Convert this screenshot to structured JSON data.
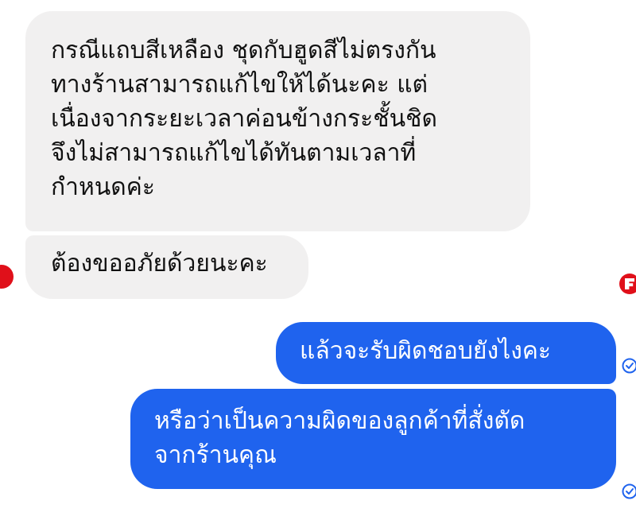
{
  "conversation": {
    "messages": [
      {
        "direction": "incoming",
        "text": "กรณีแถบสีเหลือง ชุดกับฮูดสีไม่ตรงกัน\nทางร้านสามารถแก้ไขให้ได้นะคะ แต่\nเนื่องจากระยะเวลาค่อนข้างกระชั้นชิด\nจึงไม่สามารถแก้ไขได้ทันตามเวลาที่\nกำหนดค่ะ"
      },
      {
        "direction": "incoming",
        "text": "ต้องขออภัยด้วยนะคะ"
      },
      {
        "direction": "outgoing",
        "text": "แล้วจะรับผิดชอบยังไงคะ"
      },
      {
        "direction": "outgoing",
        "text": "หรือว่าเป็นความผิดของลูกค้าที่สั่งตัด\nจากร้านคุณ"
      }
    ]
  },
  "colors": {
    "incoming_bubble": "#f1f0f0",
    "outgoing_bubble": "#1f63ee",
    "avatar": "#e0101a",
    "status_icon": "#1f63ee"
  },
  "icons": {
    "left_avatar": "shop-avatar-icon",
    "right_avatar": "seen-avatar-icon",
    "message_status": "sent-check-circle-icon"
  }
}
